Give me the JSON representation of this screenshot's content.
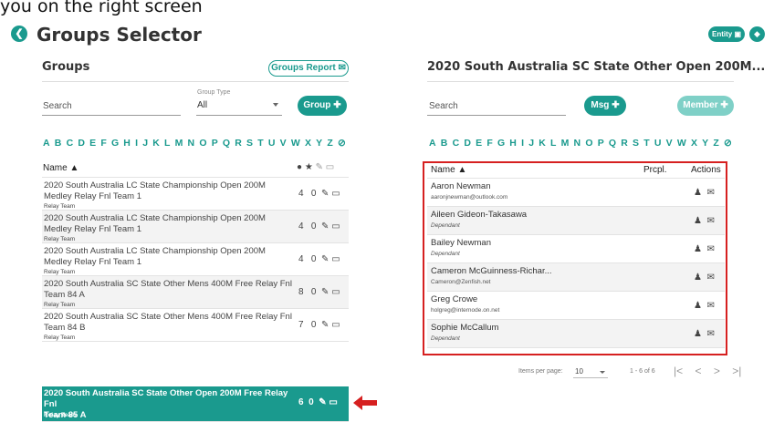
{
  "top_text": "you on the right screen",
  "header": {
    "title": "Groups Selector",
    "entity_label": "Entity"
  },
  "groups_panel": {
    "title": "Groups",
    "report_label": "Groups Report",
    "search_placeholder": "Search",
    "group_type_label": "Group Type",
    "group_type_value": "All",
    "group_button": "Group",
    "alphabet": [
      "A",
      "B",
      "C",
      "D",
      "E",
      "F",
      "G",
      "H",
      "I",
      "J",
      "K",
      "L",
      "M",
      "N",
      "O",
      "P",
      "Q",
      "R",
      "S",
      "T",
      "U",
      "V",
      "W",
      "X",
      "Y",
      "Z"
    ],
    "name_header": "Name",
    "rows": [
      {
        "line1": "2020 South Australia LC State Championship Open 200M",
        "line2": "Medley Relay Fnl Team 1",
        "type": "Relay Team",
        "count": "4",
        "stars": "0"
      },
      {
        "line1": "2020 South Australia LC State Championship Open 200M",
        "line2": "Medley Relay Fnl Team 1",
        "type": "Relay Team",
        "count": "4",
        "stars": "0"
      },
      {
        "line1": "2020 South Australia LC State Championship Open 200M",
        "line2": "Medley Relay Fnl Team 1",
        "type": "Relay Team",
        "count": "4",
        "stars": "0"
      },
      {
        "line1": "2020 South Australia SC State Other Mens 400M Free Relay Fnl",
        "line2": "Team 84 A",
        "type": "Relay Team",
        "count": "8",
        "stars": "0"
      },
      {
        "line1": "2020 South Australia SC State Other Mens 400M Free Relay Fnl",
        "line2": "Team 84 B",
        "type": "Relay Team",
        "count": "7",
        "stars": "0"
      },
      {
        "line1": "2020 South Australia SC State Other Open 200M Free Relay Fnl",
        "line2": "Team 85 A",
        "type": "Relay Team",
        "count": "6",
        "stars": "0"
      }
    ]
  },
  "members_panel": {
    "title": "2020 South Australia SC State Other Open 200M...",
    "search_placeholder": "Search",
    "msg_button": "Msg",
    "member_button": "Member",
    "alphabet": [
      "A",
      "B",
      "C",
      "D",
      "E",
      "F",
      "G",
      "H",
      "I",
      "J",
      "K",
      "L",
      "M",
      "N",
      "O",
      "P",
      "Q",
      "R",
      "S",
      "T",
      "U",
      "V",
      "W",
      "X",
      "Y",
      "Z"
    ],
    "name_header": "Name",
    "prcpl_header": "Prcpl.",
    "actions_header": "Actions",
    "members": [
      {
        "name": "Aaron Newman",
        "sub": "aaronjnewman@outlook.com"
      },
      {
        "name": "Aileen Gideon-Takasawa",
        "sub": "Dependant"
      },
      {
        "name": "Bailey Newman",
        "sub": "Dependant"
      },
      {
        "name": "Cameron McGuinness-Richar...",
        "sub": "Cameron@Zenfish.net"
      },
      {
        "name": "Greg Crowe",
        "sub": "holgreg@internode.on.net"
      },
      {
        "name": "Sophie McCallum",
        "sub": "Dependant"
      }
    ],
    "pager": {
      "items_per_page_label": "Items per page:",
      "items_per_page_value": "10",
      "range": "1 - 6 of 6"
    }
  },
  "colors": {
    "accent": "#1a9a8e",
    "highlight": "#d62020"
  }
}
